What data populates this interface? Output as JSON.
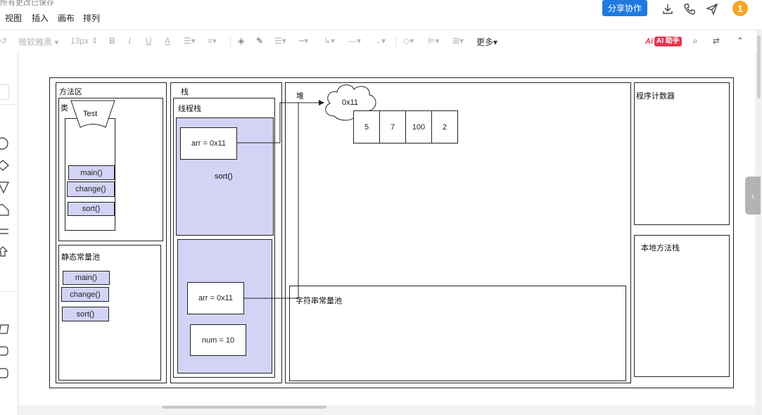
{
  "header": {
    "save_status": "所有更改已保存",
    "menu": [
      "视图",
      "插入",
      "画布",
      "排列"
    ],
    "share_label": "分享协作",
    "avatar": "1"
  },
  "toolbar": {
    "font_name": "微软雅黑",
    "font_size": "13px",
    "bold": "B",
    "italic": "I",
    "underline": "U",
    "font_color": "A",
    "more": "更多",
    "ai_a": "Ai",
    "ai_label": "AI 助手"
  },
  "diagram": {
    "method_area": "方法区",
    "class_label": "类",
    "class_name": "Test",
    "class_methods": [
      "main()",
      "change()",
      "sort()"
    ],
    "static_pool": "静态常量池",
    "static_methods": [
      "main()",
      "change()",
      "sort()"
    ],
    "stack": "栈",
    "thread_stack": "线程栈",
    "frame1_var": "arr = 0x11",
    "frame1_name": "sort()",
    "frame2_var": "arr = 0x11",
    "frame2_num": "num = 10",
    "heap": "堆",
    "heap_addr": "0x11",
    "array_values": [
      "5",
      "7",
      "100",
      "2"
    ],
    "string_pool": "字符串常量池",
    "program_counter": "程序计数器",
    "native_stack": "本地方法栈"
  },
  "colors": {
    "accent": "#1f7ae0",
    "frame_fill": "#d3d3f5",
    "avatar": "#f6a623",
    "ai": "#e8344e"
  }
}
